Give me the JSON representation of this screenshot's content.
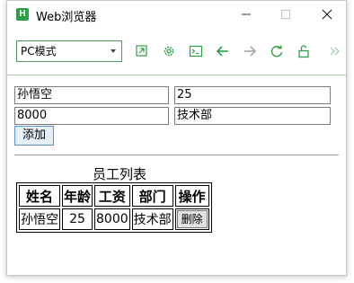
{
  "window": {
    "title": "Web浏览器",
    "app_icon_letter": "H",
    "controls": {
      "minimize": "—",
      "maximize": "☐",
      "close": "✕"
    }
  },
  "toolbar": {
    "mode_value": "PC模式",
    "icons": [
      "open-in-icon",
      "gear-icon",
      "terminal-icon",
      "back-arrow-icon",
      "forward-arrow-icon",
      "refresh-icon",
      "unlock-icon",
      "more-chevron-icon"
    ],
    "accent_color": "#2e9e44"
  },
  "form": {
    "name_value": "孙悟空",
    "age_value": "25",
    "salary_value": "8000",
    "dept_value": "技术部",
    "add_label": "添加"
  },
  "table": {
    "caption": "员工列表",
    "headers": [
      "姓名",
      "年龄",
      "工资",
      "部门",
      "操作"
    ],
    "rows": [
      {
        "name": "孙悟空",
        "age": "25",
        "salary": "8000",
        "dept": "技术部",
        "action": "删除"
      }
    ]
  }
}
